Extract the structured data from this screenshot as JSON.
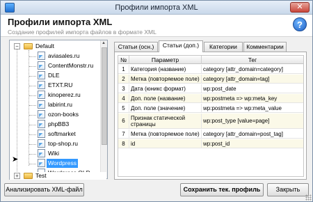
{
  "window": {
    "title": "Профили импорта XML",
    "close_label": "✕"
  },
  "header": {
    "title": "Профили импорта XML",
    "subtitle": "Создание профилей импорта файлов в формате XML",
    "help_label": "?"
  },
  "tree": {
    "default_folder": "Default",
    "items": [
      "aviasales.ru",
      "ContentMonstr.ru",
      "DLE",
      "ETXT.RU",
      "kinoperez.ru",
      "labirint.ru",
      "ozon-books",
      "phpBB3",
      "softmarket",
      "top-shop.ru",
      "Wiki",
      "Wordpress",
      "Wordpress OLD"
    ],
    "selected": "Wordpress",
    "test_folder": "Test",
    "expander_minus": "−",
    "expander_plus": "+",
    "pointer": "➤"
  },
  "tabs": [
    "Статьи (осн.)",
    "Статьи (доп.)",
    "Категории",
    "Комментарии"
  ],
  "active_tab": "Статьи (доп.)",
  "grid": {
    "headers": [
      "№",
      "Параметр",
      "Тег"
    ],
    "rows": [
      {
        "n": "1",
        "param": "Категория (название)",
        "tag": "category [attr_domain=category]"
      },
      {
        "n": "2",
        "param": "Метка (повторяемое поле)",
        "tag": "category [attr_domain=tag]"
      },
      {
        "n": "3",
        "param": "Дата (юникс формат)",
        "tag": "wp:post_date"
      },
      {
        "n": "4",
        "param": "Доп. поле (название)",
        "tag": "wp:postmeta => wp:meta_key"
      },
      {
        "n": "5",
        "param": "Доп. поле (значение)",
        "tag": "wp:postmeta => wp:meta_value"
      },
      {
        "n": "6",
        "param": "Признак статической страницы",
        "tag": "wp:post_type [value=page]"
      },
      {
        "n": "7",
        "param": "Метка (повторяемое поле)",
        "tag": "category [attr_domain=post_tag]"
      },
      {
        "n": "8",
        "param": "id",
        "tag": "wp:post_id"
      }
    ]
  },
  "buttons": {
    "analyze": "Анализировать XML-файл",
    "save": "Сохранить тек. профиль",
    "close": "Закрыть"
  }
}
